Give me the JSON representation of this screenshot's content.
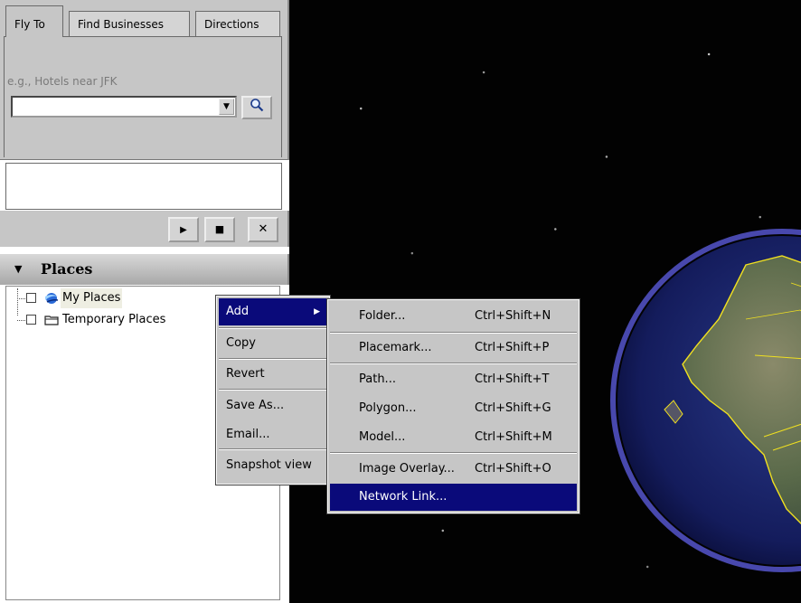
{
  "search": {
    "tabs": [
      {
        "label": "Fly To",
        "active": true
      },
      {
        "label": "Find Businesses",
        "active": false
      },
      {
        "label": "Directions",
        "active": false
      }
    ],
    "hint": "e.g., Hotels near JFK",
    "query": "",
    "search_button_icon": "magnifier-icon",
    "dropdown_icon": "triangle-down-icon"
  },
  "tour_controls": {
    "play_icon": "play-icon",
    "stop_icon": "stop-icon",
    "close_icon": "close-icon",
    "play": "▶",
    "stop": "■",
    "close": "✕"
  },
  "places": {
    "title": "Places",
    "items": [
      {
        "label": "My Places",
        "icon": "globe-icon",
        "checked": false
      },
      {
        "label": "Temporary Places",
        "icon": "folder-icon",
        "checked": false
      }
    ]
  },
  "context_menu": {
    "items": [
      {
        "label": "Add",
        "has_submenu": true,
        "highlighted": true
      },
      {
        "label": "Copy"
      },
      {
        "label": "Revert"
      },
      {
        "label": "Save As..."
      },
      {
        "label": "Email..."
      },
      {
        "label": "Snapshot view"
      }
    ]
  },
  "add_submenu": {
    "items": [
      {
        "label": "Folder...",
        "shortcut": "Ctrl+Shift+N"
      },
      {
        "label": "Placemark...",
        "shortcut": "Ctrl+Shift+P"
      },
      {
        "label": "Path...",
        "shortcut": "Ctrl+Shift+T"
      },
      {
        "label": "Polygon...",
        "shortcut": "Ctrl+Shift+G"
      },
      {
        "label": "Model...",
        "shortcut": "Ctrl+Shift+M"
      },
      {
        "label": "Image Overlay...",
        "shortcut": "Ctrl+Shift+O"
      },
      {
        "label": "Network Link...",
        "shortcut": "",
        "highlighted": true
      }
    ]
  },
  "colors": {
    "menu_highlight": "#0a0a7a",
    "panel_gray": "#c6c6c6",
    "space": "#020202",
    "border_lines": "#f0e020"
  }
}
